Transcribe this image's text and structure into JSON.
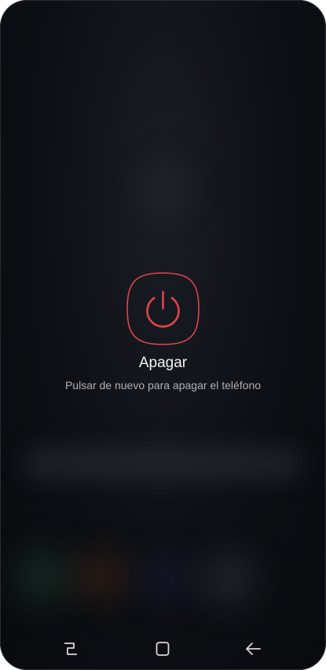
{
  "power_menu": {
    "title": "Apagar",
    "subtitle": "Pulsar de nuevo para apagar el teléfono",
    "icon": "power-icon",
    "accent_color": "#e0444a"
  },
  "nav_bar": {
    "buttons": [
      {
        "icon": "recent-apps-icon"
      },
      {
        "icon": "home-icon"
      },
      {
        "icon": "back-arrow-icon"
      }
    ],
    "icon_color": "#d8d9dc"
  },
  "background_color": "#0d0f14"
}
